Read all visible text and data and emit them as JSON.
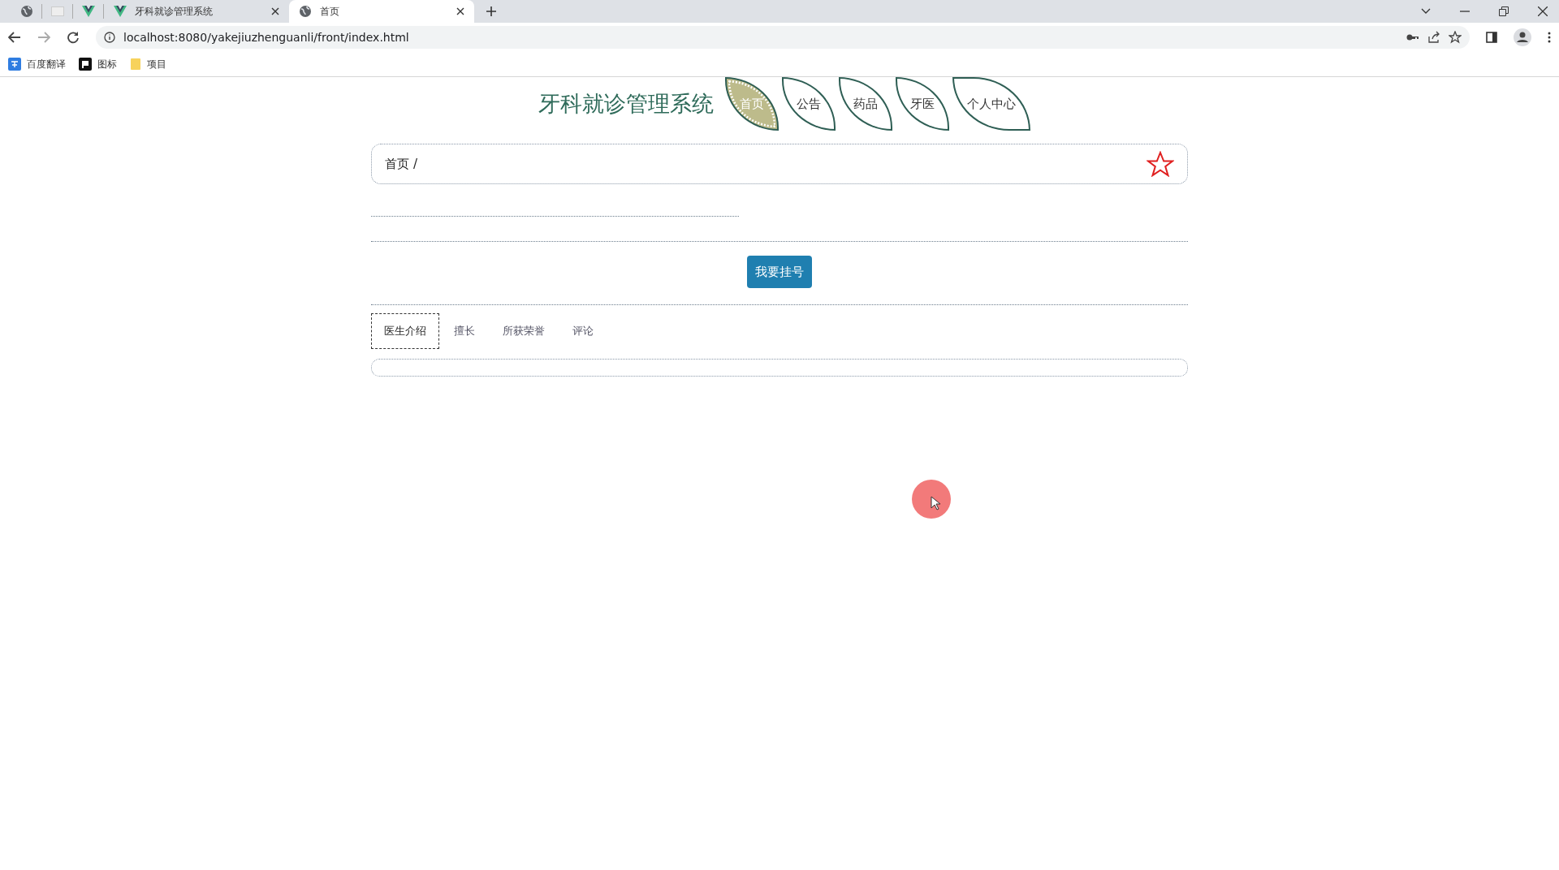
{
  "browser": {
    "tabs": [
      {
        "title": "牙科就诊管理系统",
        "selected": false
      },
      {
        "title": "首页",
        "selected": true
      }
    ],
    "url": "localhost:8080/yakejiuzhenguanli/front/index.html",
    "bookmarks": [
      {
        "label": "百度翻译",
        "kind": "translate"
      },
      {
        "label": "图标",
        "kind": "flag"
      },
      {
        "label": "项目",
        "kind": "folder"
      }
    ]
  },
  "site": {
    "title": "牙科就诊管理系统",
    "nav": [
      {
        "label": "首页",
        "selected": true
      },
      {
        "label": "公告",
        "selected": false
      },
      {
        "label": "药品",
        "selected": false
      },
      {
        "label": "牙医",
        "selected": false
      },
      {
        "label": "个人中心",
        "selected": false
      }
    ]
  },
  "breadcrumb": {
    "items": [
      "首页"
    ],
    "separator": "/"
  },
  "register_button": "我要挂号",
  "detail_tabs": [
    {
      "label": "医生介绍",
      "selected": true
    },
    {
      "label": "擅长",
      "selected": false
    },
    {
      "label": "所获荣誉",
      "selected": false
    },
    {
      "label": "评论",
      "selected": false
    }
  ]
}
